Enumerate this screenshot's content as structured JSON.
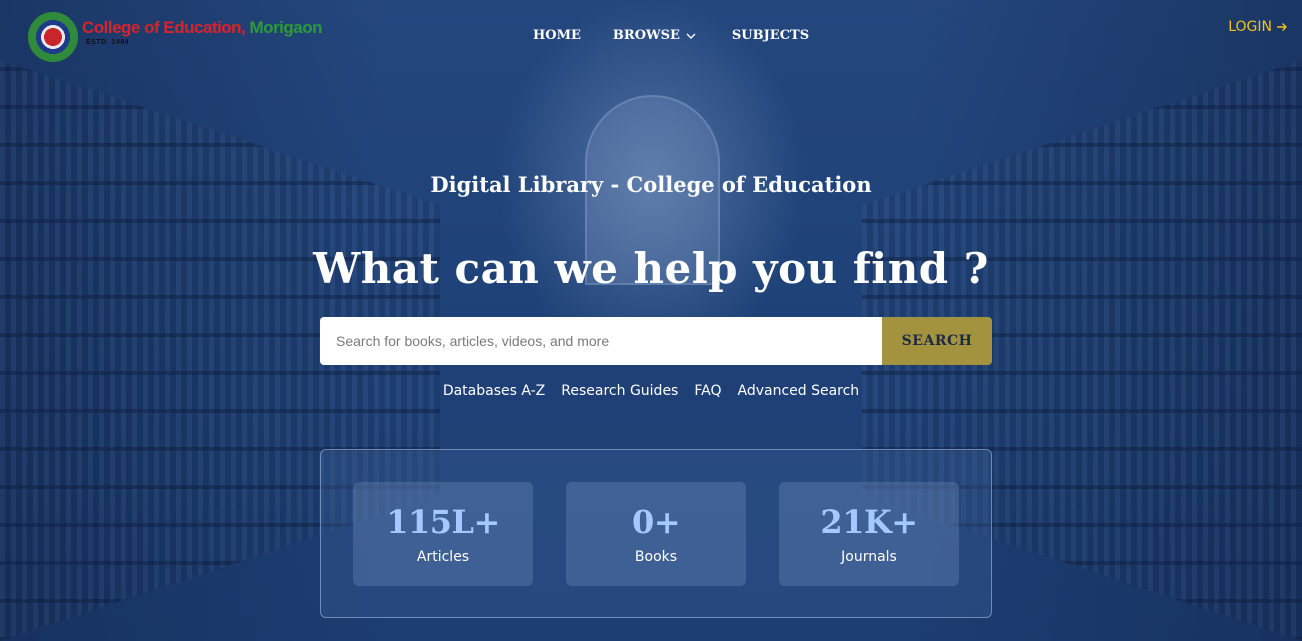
{
  "colors": {
    "background": "#1d3f73",
    "accent_gold": "#f2c318",
    "search_button": "#a3923e",
    "stat_value": "#a5c8ff"
  },
  "logo": {
    "name_part1": "College of Education,",
    "name_part2": " Morigaon",
    "estd": "ESTD. 1994",
    "icon": "college-emblem-icon"
  },
  "nav": {
    "home": "HOME",
    "browse": "BROWSE",
    "subjects": "SUBJECTS"
  },
  "login": {
    "label": "LOGIN",
    "icon": "arrow-right-icon"
  },
  "hero": {
    "subtitle": "Digital Library - College of Education",
    "headline": "What can we help you find ?"
  },
  "search": {
    "placeholder": "Search for books, articles, videos, and more",
    "value": "",
    "button": "SEARCH"
  },
  "quick_links": [
    "Databases A-Z",
    "Research Guides",
    "FAQ",
    "Advanced Search"
  ],
  "stats": [
    {
      "value": "115L+",
      "label": "Articles"
    },
    {
      "value": "0+",
      "label": "Books"
    },
    {
      "value": "21K+",
      "label": "Journals"
    }
  ]
}
